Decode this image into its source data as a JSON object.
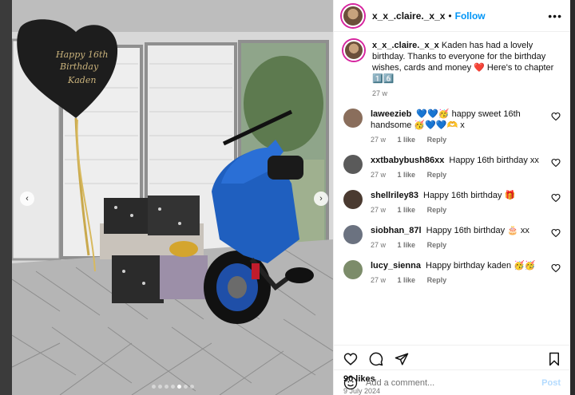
{
  "post": {
    "username": "x_x_.claire._x_x",
    "follow_label": "Follow",
    "more_glyph": "•••",
    "separator": "•",
    "caption": {
      "username": "x_x_.claire._x_x",
      "text": "Kaden has had a lovely birthday. Thanks to everyone for the birthday wishes, cards and money ❤️ Here's to chapter 1️⃣6️⃣",
      "age": "27 w"
    },
    "balloon_text": [
      "Happy 16th",
      "Birthday",
      "Kaden"
    ],
    "carousel": {
      "total": 7,
      "active": 4
    },
    "likes": "90 likes",
    "date": "9 July 2024",
    "comment_placeholder": "Add a comment...",
    "post_label": "Post"
  },
  "comments": [
    {
      "username": "laweezieb",
      "text": "💙💙🥳 happy sweet 16th handsome 🥳💙💙🫶 x",
      "age": "27 w",
      "likes": "1 like",
      "reply": "Reply",
      "avatar_color": "#8a6e5c"
    },
    {
      "username": "xxtbabybush86xx",
      "text": "Happy 16th birthday xx",
      "age": "27 w",
      "likes": "1 like",
      "reply": "Reply",
      "avatar_color": "#5a5a5a"
    },
    {
      "username": "shellriley83",
      "text": "Happy 16th birthday 🎁",
      "age": "27 w",
      "likes": "1 like",
      "reply": "Reply",
      "avatar_color": "#4a3a30"
    },
    {
      "username": "siobhan_87l",
      "text": "Happy 16th birthday 🎂 xx",
      "age": "27 w",
      "likes": "1 like",
      "reply": "Reply",
      "avatar_color": "#6b7280"
    },
    {
      "username": "lucy_sienna",
      "text": "Happy birthday kaden 🥳🥳",
      "age": "27 w",
      "likes": "1 like",
      "reply": "Reply",
      "avatar_color": "#7c8c6a"
    }
  ],
  "colors": {
    "follow": "#0095f6",
    "story_ring": "#d6249f",
    "scooter": "#1f5fbf"
  }
}
